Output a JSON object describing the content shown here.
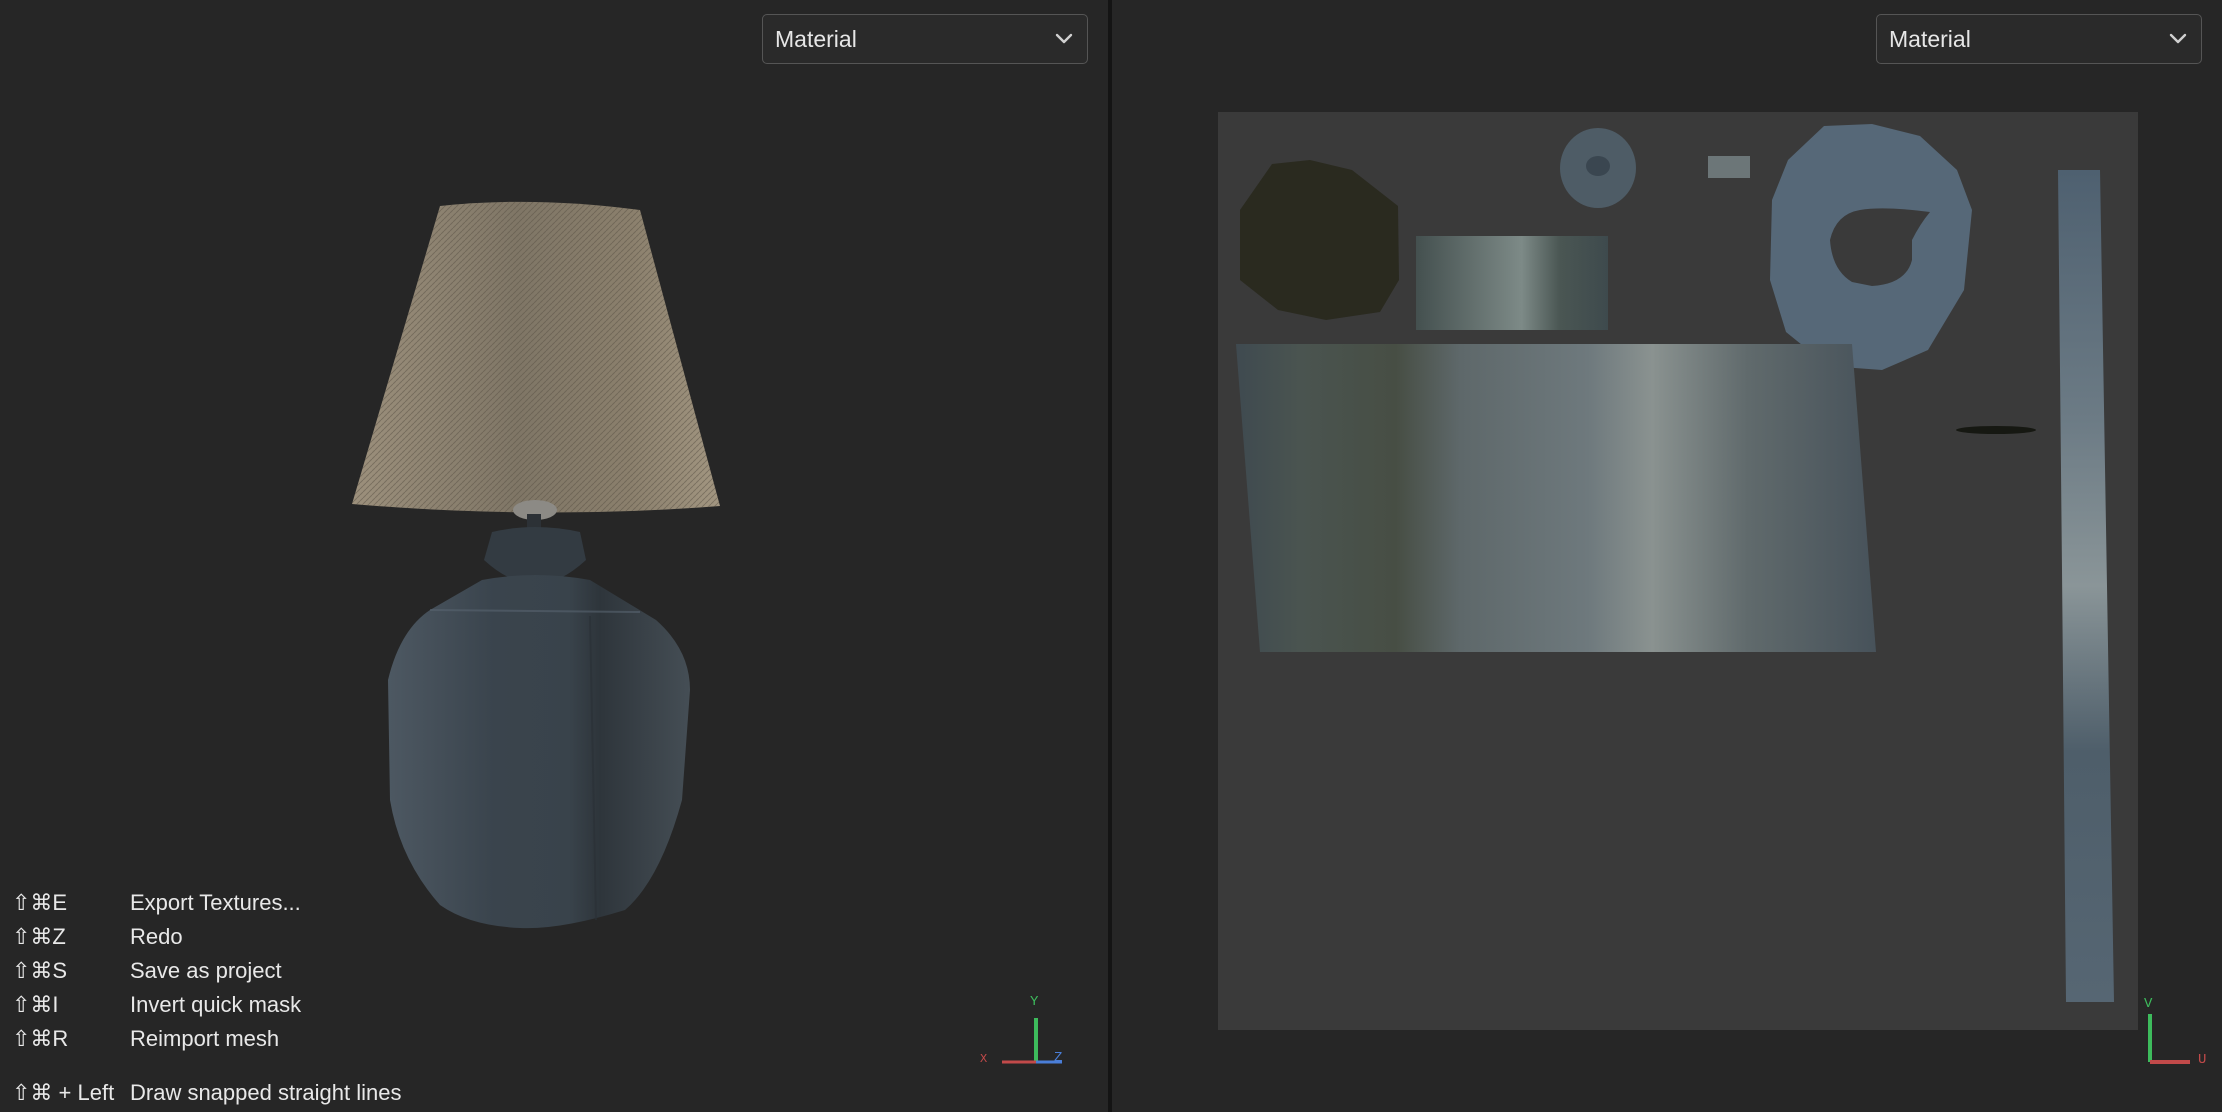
{
  "viewport_3d": {
    "dropdown_label": "Material",
    "axis": {
      "y": "Y",
      "x": "X",
      "z": "Z"
    }
  },
  "viewport_uv": {
    "dropdown_label": "Material",
    "axis": {
      "v": "V",
      "u": "U"
    }
  },
  "shortcuts": [
    {
      "keys": "⇧⌘E",
      "action": "Export Textures..."
    },
    {
      "keys": "⇧⌘Z",
      "action": "Redo"
    },
    {
      "keys": "⇧⌘S",
      "action": "Save as project"
    },
    {
      "keys": "⇧⌘I",
      "action": "Invert quick mask"
    },
    {
      "keys": "⇧⌘R",
      "action": "Reimport mesh"
    },
    {
      "keys": "⇧⌘ + Left",
      "action": "Draw snapped straight lines"
    }
  ],
  "colors": {
    "background": "#262626",
    "uv_sheet": "#3a3a3a",
    "shade": "#8e8370",
    "vase": "#3d4650",
    "axis_y": "#3dbb5c",
    "axis_x": "#c24a4a",
    "axis_z": "#4a7ed8"
  },
  "icons": {
    "dropdown": "chevron-down-icon"
  }
}
